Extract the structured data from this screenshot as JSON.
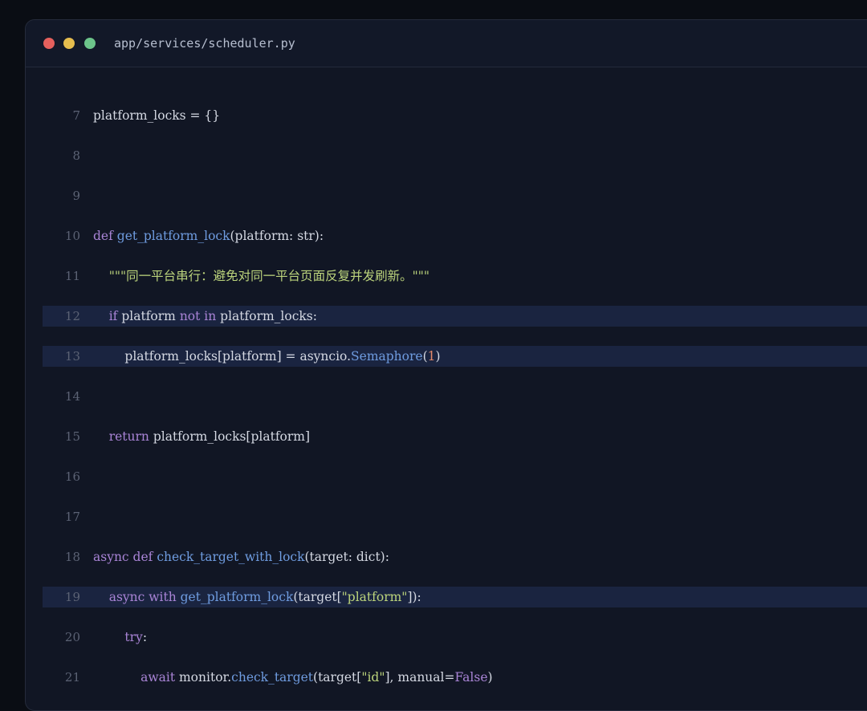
{
  "window": {
    "filename": "app/services/scheduler.py",
    "controls": [
      {
        "name": "close",
        "color": "#e5605d"
      },
      {
        "name": "minimize",
        "color": "#e6bd4e"
      },
      {
        "name": "maximize",
        "color": "#6cc48a"
      }
    ]
  },
  "colors": {
    "keyword": "#a984d6",
    "function": "#6f9ce0",
    "string": "#bcd47c",
    "number": "#e58a6b",
    "text": "#d5d9e3",
    "line_number": "#5b6274",
    "highlight": "#1a2440"
  },
  "lines": [
    {
      "n": "7",
      "hl": false,
      "tokens": [
        {
          "t": "platform_locks = {}",
          "k": "plain"
        }
      ]
    },
    {
      "n": "8",
      "hl": false,
      "tokens": []
    },
    {
      "n": "9",
      "hl": false,
      "tokens": []
    },
    {
      "n": "10",
      "hl": false,
      "tokens": [
        {
          "t": "def ",
          "k": "kw"
        },
        {
          "t": "get_platform_lock",
          "k": "fn"
        },
        {
          "t": "(platform: str):",
          "k": "plain"
        }
      ]
    },
    {
      "n": "11",
      "hl": false,
      "tokens": [
        {
          "t": "    ",
          "k": "plain"
        },
        {
          "t": "\"\"\"同一平台串行：避免对同一平台页面反复并发刷新。\"\"\"",
          "k": "str"
        }
      ]
    },
    {
      "n": "12",
      "hl": true,
      "tokens": [
        {
          "t": "    ",
          "k": "plain"
        },
        {
          "t": "if",
          "k": "kw"
        },
        {
          "t": " platform ",
          "k": "plain"
        },
        {
          "t": "not in",
          "k": "kw"
        },
        {
          "t": " platform_locks:",
          "k": "plain"
        }
      ]
    },
    {
      "n": "13",
      "hl": true,
      "tokens": [
        {
          "t": "        platform_locks[platform] = asyncio.",
          "k": "plain"
        },
        {
          "t": "Semaphore",
          "k": "fn"
        },
        {
          "t": "(",
          "k": "plain"
        },
        {
          "t": "1",
          "k": "num"
        },
        {
          "t": ")",
          "k": "plain"
        }
      ]
    },
    {
      "n": "14",
      "hl": false,
      "tokens": []
    },
    {
      "n": "15",
      "hl": false,
      "tokens": [
        {
          "t": "    ",
          "k": "plain"
        },
        {
          "t": "return",
          "k": "kw"
        },
        {
          "t": " platform_locks[platform]",
          "k": "plain"
        }
      ]
    },
    {
      "n": "16",
      "hl": false,
      "tokens": []
    },
    {
      "n": "17",
      "hl": false,
      "tokens": []
    },
    {
      "n": "18",
      "hl": false,
      "tokens": [
        {
          "t": "async def ",
          "k": "kw"
        },
        {
          "t": "check_target_with_lock",
          "k": "fn"
        },
        {
          "t": "(target: dict):",
          "k": "plain"
        }
      ]
    },
    {
      "n": "19",
      "hl": true,
      "tokens": [
        {
          "t": "    ",
          "k": "plain"
        },
        {
          "t": "async with ",
          "k": "kw"
        },
        {
          "t": "get_platform_lock",
          "k": "fn"
        },
        {
          "t": "(target[",
          "k": "plain"
        },
        {
          "t": "\"platform\"",
          "k": "str"
        },
        {
          "t": "]):",
          "k": "plain"
        }
      ]
    },
    {
      "n": "20",
      "hl": false,
      "tokens": [
        {
          "t": "        ",
          "k": "plain"
        },
        {
          "t": "try",
          "k": "kw"
        },
        {
          "t": ":",
          "k": "plain"
        }
      ]
    },
    {
      "n": "21",
      "hl": false,
      "tokens": [
        {
          "t": "            ",
          "k": "plain"
        },
        {
          "t": "await",
          "k": "kw"
        },
        {
          "t": " monitor.",
          "k": "plain"
        },
        {
          "t": "check_target",
          "k": "fn"
        },
        {
          "t": "(target[",
          "k": "plain"
        },
        {
          "t": "\"id\"",
          "k": "str"
        },
        {
          "t": "], manual=",
          "k": "plain"
        },
        {
          "t": "False",
          "k": "kw"
        },
        {
          "t": ")",
          "k": "plain"
        }
      ]
    }
  ]
}
